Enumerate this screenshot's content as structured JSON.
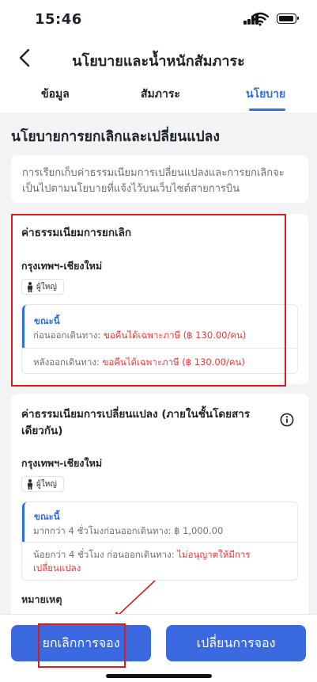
{
  "status_bar": {
    "time": "15:46"
  },
  "header": {
    "title": "นโยบายและน้ำหนักสัมภาระ"
  },
  "tabs": [
    {
      "label": "ข้อมูล"
    },
    {
      "label": "สัมภาระ"
    },
    {
      "label": "นโยบาย"
    }
  ],
  "active_tab": "นโยบาย",
  "section": {
    "title": "นโยบายการยกเลิกและเปลี่ยนแปลง",
    "info": "การเรียกเก็บค่าธรรมเนียมการเปลี่ยนแปลงและการยกเลิกจะเป็นไปตามนโยบายที่แจ้งไว้บนเว็บไซต์สายการบิน"
  },
  "cancel_fee": {
    "heading": "ค่าธรรมเนียมการยกเลิก",
    "route": "กรุงเทพฯ-เชียงใหม่",
    "passenger": "ผู้ใหญ่",
    "now_label": "ขณะนี้",
    "before_label": "ก่อนออกเดินทาง: ",
    "before_value": "ขอคืนได้เฉพาะภาษี (฿ 130.00/คน)",
    "after_label": "หลังออกเดินทาง: ",
    "after_value": "ขอคืนได้เฉพาะภาษี (฿ 130.00/คน)"
  },
  "change_fee": {
    "heading": "ค่าธรรมเนียมการเปลี่ยนแปลง (ภายในชั้นโดยสารเดียวกัน)",
    "route": "กรุงเทพฯ-เชียงใหม่",
    "passenger": "ผู้ใหญ่",
    "now_label": "ขณะนี้",
    "more_than": "มากกว่า 4 ชั่วโมงก่อนออกเดินทาง: ฿ 1,000.00",
    "less_than_label": "น้อยกว่า 4 ชั่วโมง ก่อนออกเดินทาง: ",
    "less_than_value": "ไม่อนุญาตให้มีการเปลี่ยนแปลง",
    "note_label": "หมายเหตุ"
  },
  "buttons": {
    "cancel": "ยกเลิกการจอง",
    "change": "เปลี่ยนการจอง"
  },
  "colors": {
    "accent": "#3b6ae0",
    "warning_text": "#e53935",
    "annotation": "#d91c1c"
  },
  "icons": [
    "back-chevron-icon",
    "signal-icon",
    "wifi-icon",
    "battery-icon",
    "person-icon",
    "info-icon"
  ]
}
